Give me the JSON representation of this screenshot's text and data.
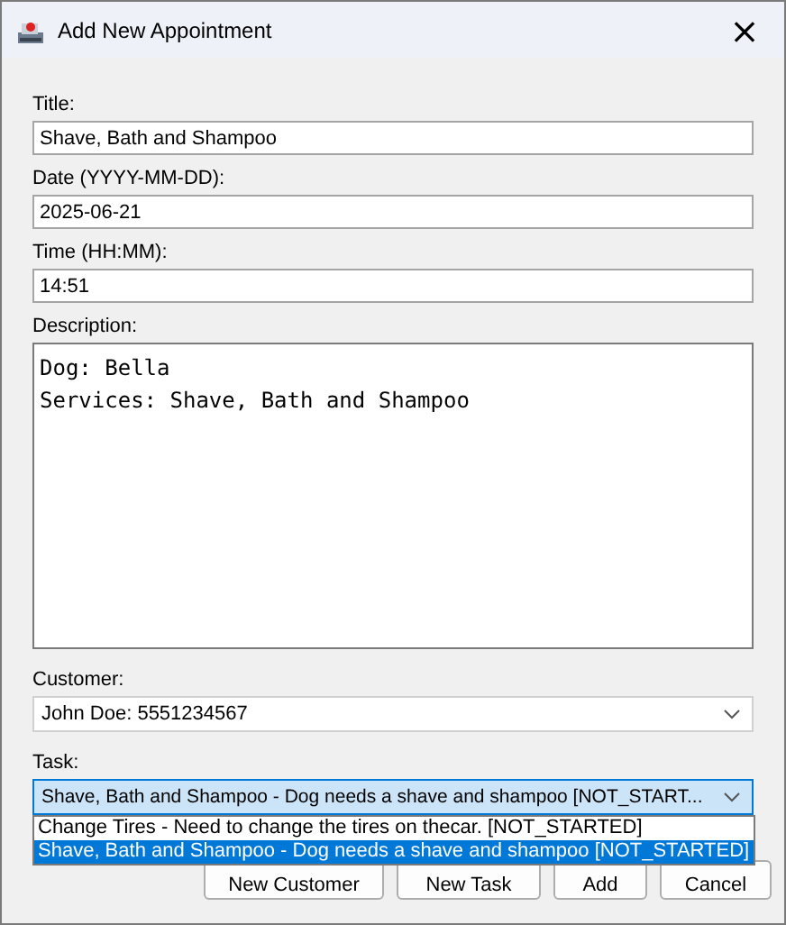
{
  "window": {
    "title": "Add New Appointment",
    "close": "×"
  },
  "fields": [
    {
      "label": "Title:",
      "value": "Shave, Bath and Shampoo"
    },
    {
      "label": "Date (YYYY-MM-DD):",
      "value": "2025-06-21"
    },
    {
      "label": "Time (HH:MM):",
      "value": "14:51"
    }
  ],
  "description": {
    "label": "Description:",
    "lines": [
      "Dog: Bella",
      "Services: Shave, Bath and Shampoo"
    ]
  },
  "customer": {
    "label": "Customer:",
    "value": "John Doe: 5551234567",
    "focused": false
  },
  "task": {
    "label": "Task:",
    "value": "Shave, Bath and Shampoo - Dog needs a shave and shampoo [NOT_START...",
    "focused": true,
    "options": [
      {
        "label": "Change Tires - Need to change the tires on thecar. [NOT_STARTED]",
        "selected": false
      },
      {
        "label": "Shave, Bath and Shampoo - Dog needs a shave and shampoo [NOT_STARTED]",
        "selected": true
      }
    ]
  },
  "buttons": [
    "New Customer",
    "New Task",
    "Add",
    "Cancel"
  ]
}
